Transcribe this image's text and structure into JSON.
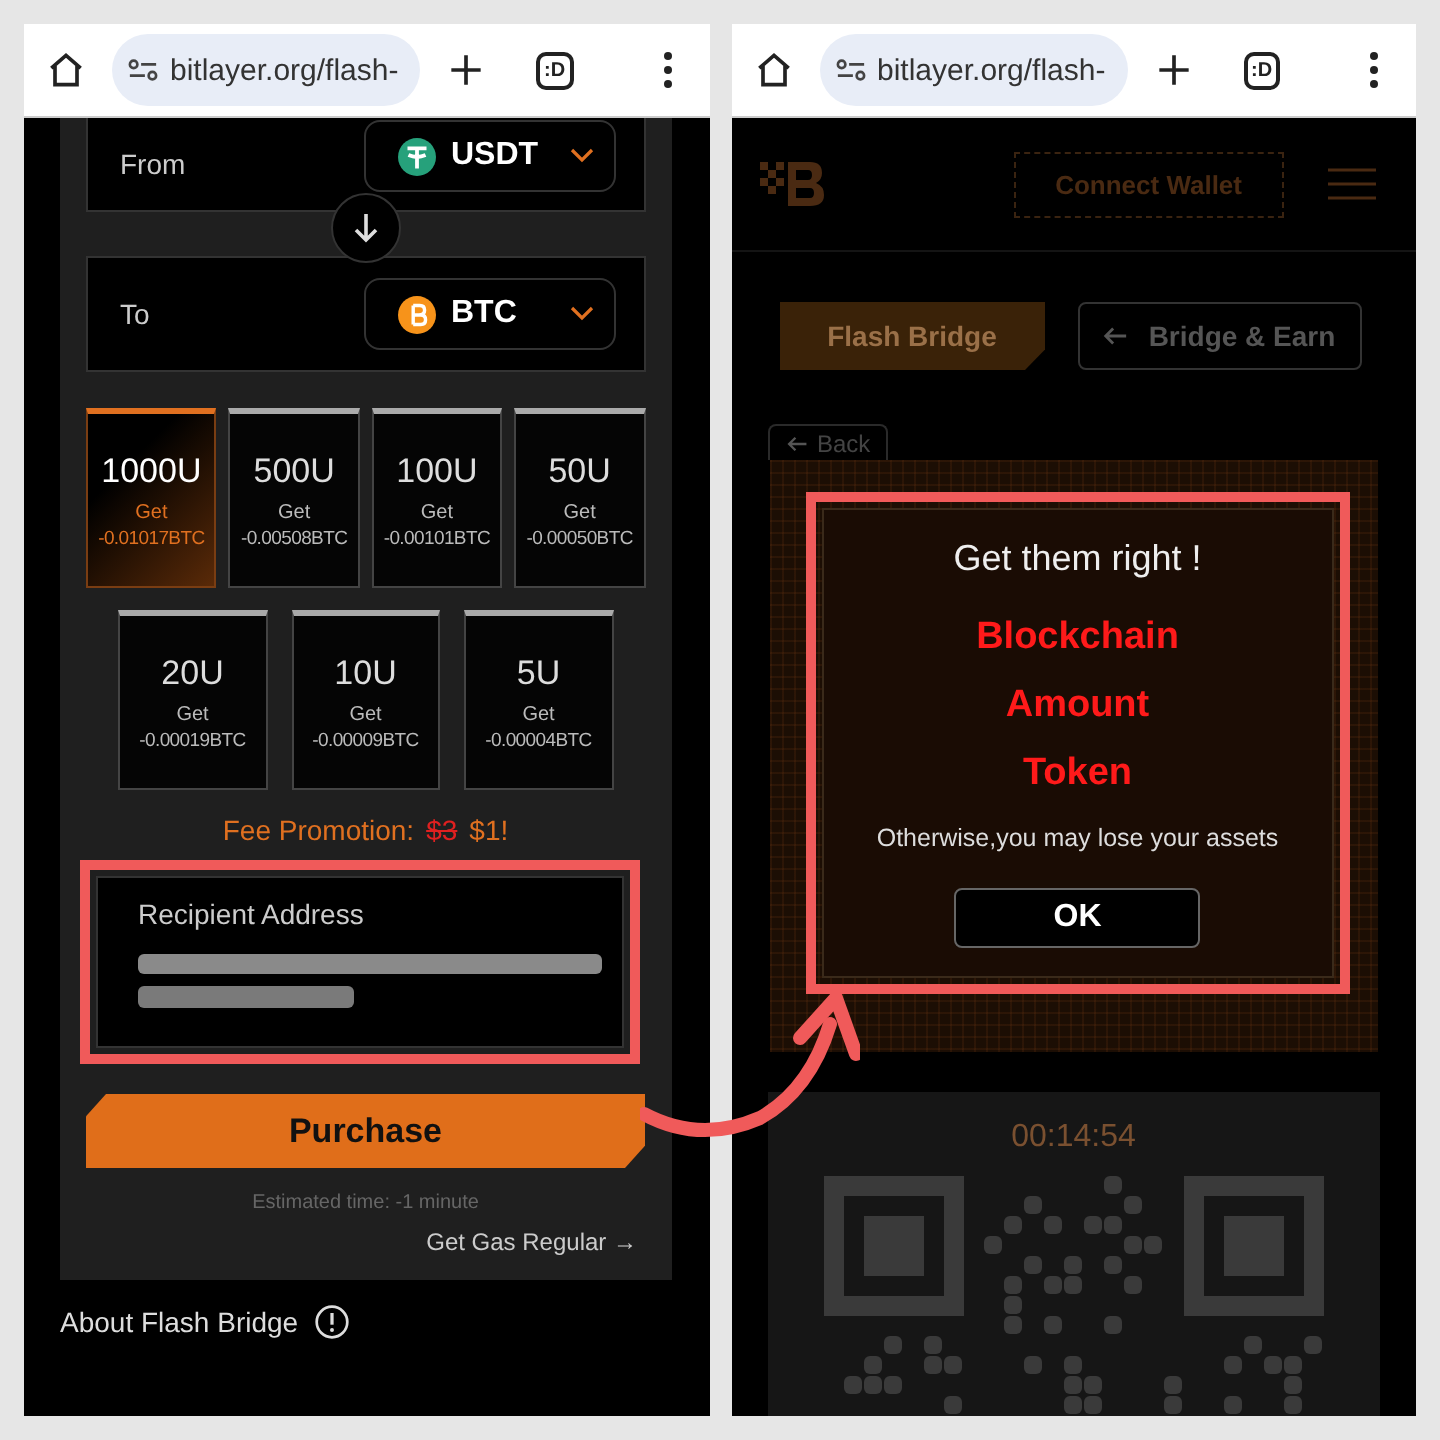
{
  "left_screen": {
    "browser": {
      "url": "bitlayer.org/flash-",
      "tab_switcher": ":D"
    },
    "swap": [
      {
        "label": "From",
        "token": "USDT",
        "kind": "usdt"
      },
      {
        "label": "To",
        "token": "BTC",
        "kind": "btc"
      }
    ],
    "amounts": [
      {
        "amount": "1000U",
        "get_label": "Get",
        "estimate": "-0.01017BTC",
        "selected": true
      },
      {
        "amount": "500U",
        "get_label": "Get",
        "estimate": "-0.00508BTC",
        "selected": false
      },
      {
        "amount": "100U",
        "get_label": "Get",
        "estimate": "-0.00101BTC",
        "selected": false
      },
      {
        "amount": "50U",
        "get_label": "Get",
        "estimate": "-0.00050BTC",
        "selected": false
      },
      {
        "amount": "20U",
        "get_label": "Get",
        "estimate": "-0.00019BTC",
        "selected": false
      },
      {
        "amount": "10U",
        "get_label": "Get",
        "estimate": "-0.00009BTC",
        "selected": false
      },
      {
        "amount": "5U",
        "get_label": "Get",
        "estimate": "-0.00004BTC",
        "selected": false
      }
    ],
    "fee_promotion": {
      "label": "Fee Promotion:",
      "old_price": "$3",
      "new_price": "$1!"
    },
    "recipient": {
      "label": "Recipient Address"
    },
    "purchase_button": "Purchase",
    "estimated_time": "Estimated time: -1 minute",
    "gas_link": "Get Gas Regular →",
    "about": "About Flash Bridge"
  },
  "right_screen": {
    "browser": {
      "url": "bitlayer.org/flash-",
      "tab_switcher": ":D"
    },
    "header": {
      "connect_wallet": "Connect Wallet"
    },
    "tabs": [
      {
        "label": "Flash Bridge",
        "selected": true
      },
      {
        "label": "Bridge & Earn",
        "selected": false
      }
    ],
    "back_button": "Back",
    "dialog": {
      "title": "Get them right !",
      "items": [
        "Blockchain",
        "Amount",
        "Token"
      ],
      "warning": "Otherwise,you may lose your assets",
      "button": "OK"
    },
    "timer": "00:14:54"
  }
}
